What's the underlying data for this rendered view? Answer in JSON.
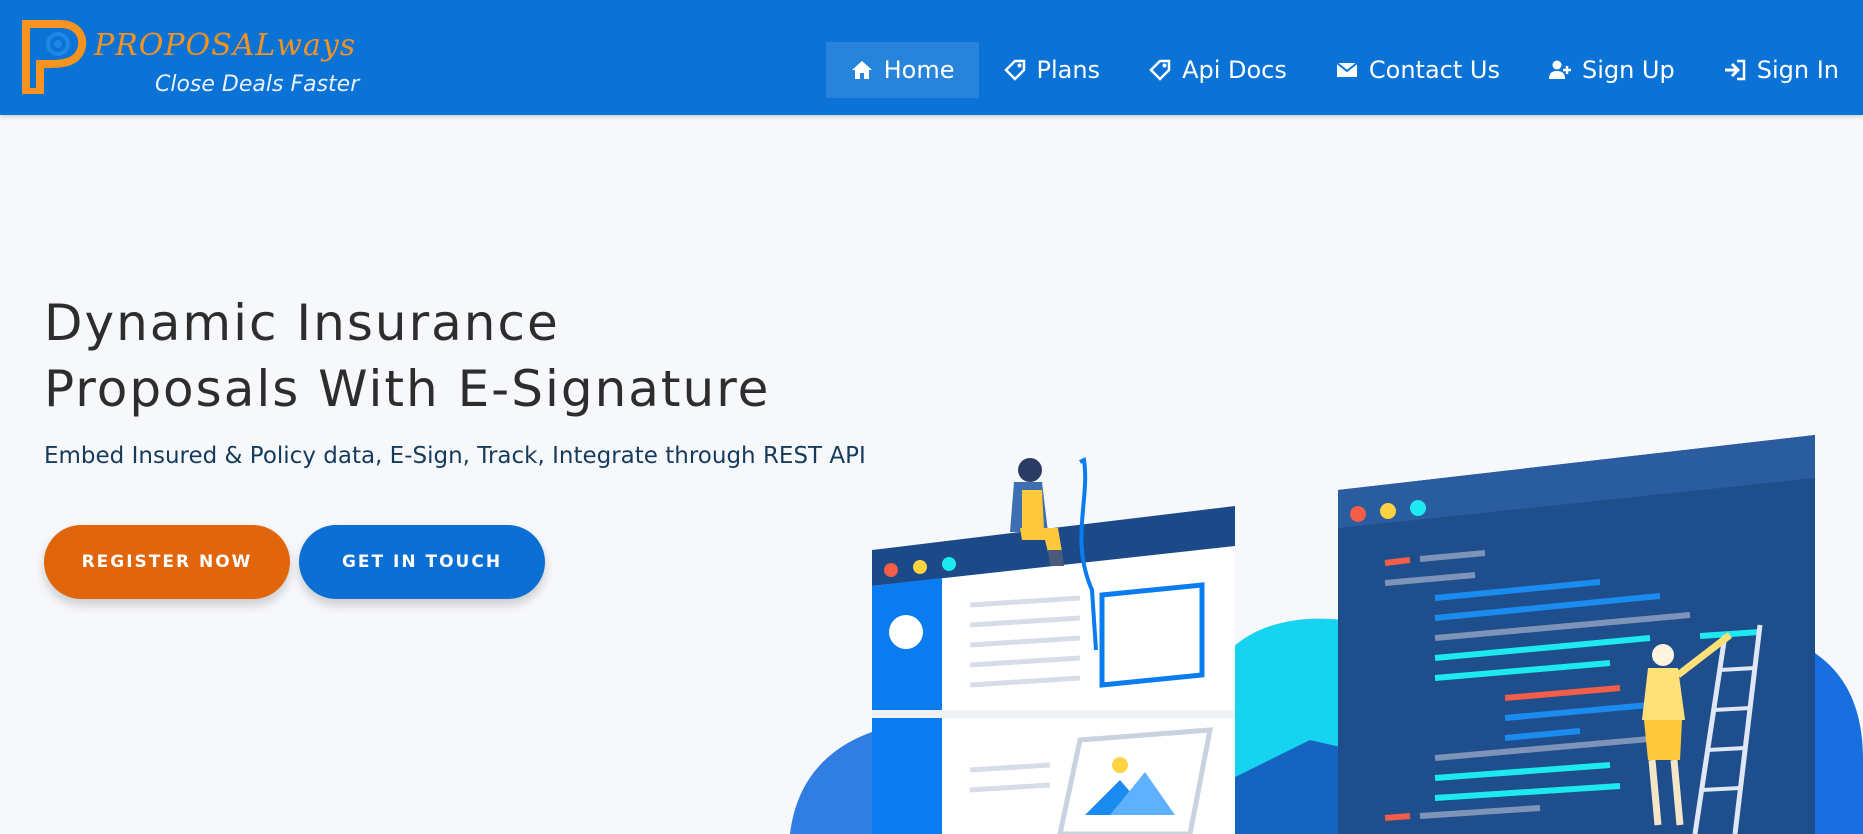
{
  "brand": {
    "logo_text": "PROPOSALways",
    "tagline": "Close Deals Faster"
  },
  "nav": {
    "items": [
      {
        "label": "Home",
        "icon": "home-icon",
        "active": true
      },
      {
        "label": "Plans",
        "icon": "tag-icon"
      },
      {
        "label": "Api Docs",
        "icon": "tag-icon"
      },
      {
        "label": "Contact Us",
        "icon": "envelope-icon"
      },
      {
        "label": "Sign Up",
        "icon": "user-plus-icon"
      },
      {
        "label": "Sign In",
        "icon": "sign-in-icon"
      }
    ]
  },
  "hero": {
    "title_line1": "Dynamic Insurance",
    "title_line2": "Proposals With E-Signature",
    "subtitle": "Embed Insured & Policy data, E-Sign, Track, Integrate through REST API",
    "register_label": "REGISTER NOW",
    "touch_label": "GET IN TOUCH"
  },
  "colors": {
    "nav_bg": "#0b72d6",
    "brand_orange": "#f7931e",
    "register_bg": "#e0650b",
    "touch_bg": "#0b6fd3"
  }
}
